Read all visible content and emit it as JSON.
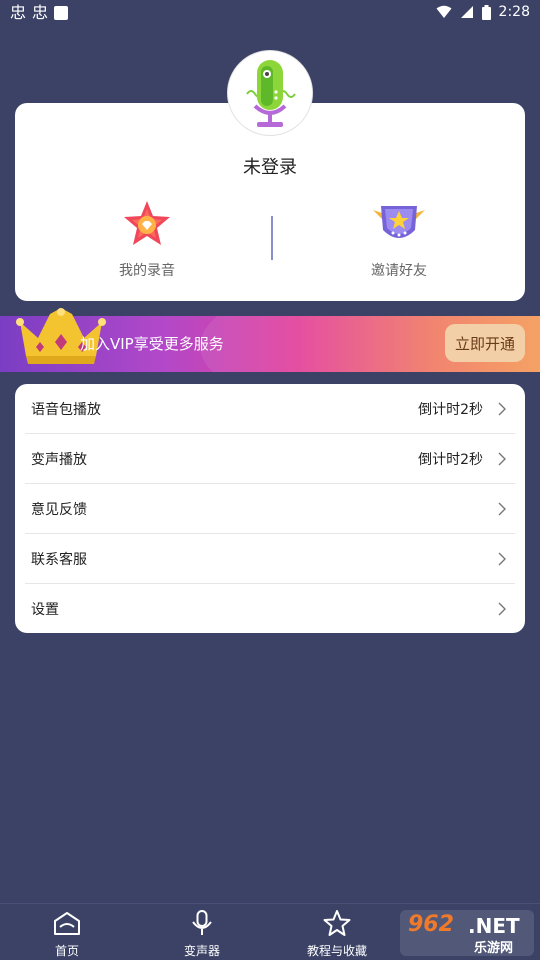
{
  "status_bar": {
    "time": "2:28",
    "left_glyph": "忠"
  },
  "profile": {
    "login_status": "未登录",
    "avatar_icon": "microphone-avatar-icon"
  },
  "quick_actions": [
    {
      "label": "我的录音",
      "icon": "star-badge-icon"
    },
    {
      "label": "邀请好友",
      "icon": "winged-star-badge-icon"
    }
  ],
  "vip": {
    "text": "加入VIP享受更多服务",
    "button": "立即开通",
    "gradient": [
      "#7a3ec4",
      "#e3409a",
      "#f59a58"
    ],
    "button_color": "#f2cfa6"
  },
  "menu": [
    {
      "label": "语音包播放",
      "value": "倒计时2秒"
    },
    {
      "label": "变声播放",
      "value": "倒计时2秒"
    },
    {
      "label": "意见反馈",
      "value": ""
    },
    {
      "label": "联系客服",
      "value": ""
    },
    {
      "label": "设置",
      "value": ""
    }
  ],
  "tabs": [
    {
      "label": "首页",
      "icon": "home-icon"
    },
    {
      "label": "变声器",
      "icon": "microphone-icon"
    },
    {
      "label": "教程与收藏",
      "icon": "star-outline-icon"
    }
  ],
  "watermark": {
    "number": "962",
    "suffix": ".NET",
    "cn": "乐游网"
  },
  "colors": {
    "background": "#3b4266",
    "card": "#ffffff"
  }
}
